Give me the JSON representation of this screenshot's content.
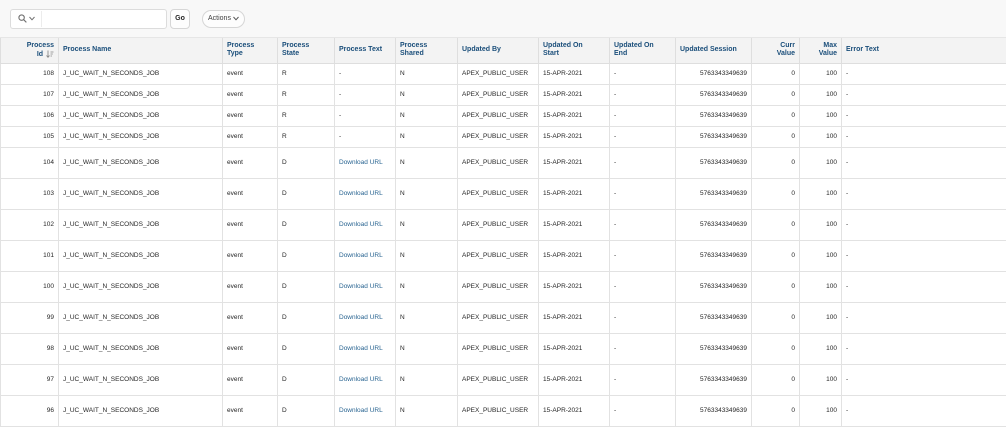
{
  "toolbar": {
    "search_value": "",
    "go_label": "Go",
    "actions_label": "Actions"
  },
  "columns": {
    "process_id": [
      "Process",
      "Id"
    ],
    "process_name": "Process Name",
    "process_type": [
      "Process",
      "Type"
    ],
    "process_state": [
      "Process",
      "State"
    ],
    "process_text": "Process Text",
    "process_shared": [
      "Process",
      "Shared"
    ],
    "updated_by": "Updated By",
    "updated_on_start": [
      "Updated On",
      "Start"
    ],
    "updated_on_end": [
      "Updated On",
      "End"
    ],
    "updated_session": "Updated Session",
    "curr_value": [
      "Curr",
      "Value"
    ],
    "max_value": [
      "Max",
      "Value"
    ],
    "error_text": "Error Text"
  },
  "rows": [
    {
      "id": "108",
      "name": "J_UC_WAIT_N_SECONDS_JOB",
      "type": "event",
      "state": "R",
      "text": "-",
      "shared": "N",
      "updated_by": "APEX_PUBLIC_USER",
      "start": "15-APR-2021",
      "end": "-",
      "session": "5763343349639",
      "curr": "0",
      "max": "100",
      "error": "-"
    },
    {
      "id": "107",
      "name": "J_UC_WAIT_N_SECONDS_JOB",
      "type": "event",
      "state": "R",
      "text": "-",
      "shared": "N",
      "updated_by": "APEX_PUBLIC_USER",
      "start": "15-APR-2021",
      "end": "-",
      "session": "5763343349639",
      "curr": "0",
      "max": "100",
      "error": "-"
    },
    {
      "id": "106",
      "name": "J_UC_WAIT_N_SECONDS_JOB",
      "type": "event",
      "state": "R",
      "text": "-",
      "shared": "N",
      "updated_by": "APEX_PUBLIC_USER",
      "start": "15-APR-2021",
      "end": "-",
      "session": "5763343349639",
      "curr": "0",
      "max": "100",
      "error": "-"
    },
    {
      "id": "105",
      "name": "J_UC_WAIT_N_SECONDS_JOB",
      "type": "event",
      "state": "R",
      "text": "-",
      "shared": "N",
      "updated_by": "APEX_PUBLIC_USER",
      "start": "15-APR-2021",
      "end": "-",
      "session": "5763343349639",
      "curr": "0",
      "max": "100",
      "error": "-"
    },
    {
      "id": "104",
      "name": "J_UC_WAIT_N_SECONDS_JOB",
      "type": "event",
      "state": "D",
      "text": "Download URL",
      "shared": "N",
      "updated_by": "APEX_PUBLIC_USER",
      "start": "15-APR-2021",
      "end": "-",
      "session": "5763343349639",
      "curr": "0",
      "max": "100",
      "error": "-"
    },
    {
      "id": "103",
      "name": "J_UC_WAIT_N_SECONDS_JOB",
      "type": "event",
      "state": "D",
      "text": "Download URL",
      "shared": "N",
      "updated_by": "APEX_PUBLIC_USER",
      "start": "15-APR-2021",
      "end": "-",
      "session": "5763343349639",
      "curr": "0",
      "max": "100",
      "error": "-"
    },
    {
      "id": "102",
      "name": "J_UC_WAIT_N_SECONDS_JOB",
      "type": "event",
      "state": "D",
      "text": "Download URL",
      "shared": "N",
      "updated_by": "APEX_PUBLIC_USER",
      "start": "15-APR-2021",
      "end": "-",
      "session": "5763343349639",
      "curr": "0",
      "max": "100",
      "error": "-"
    },
    {
      "id": "101",
      "name": "J_UC_WAIT_N_SECONDS_JOB",
      "type": "event",
      "state": "D",
      "text": "Download URL",
      "shared": "N",
      "updated_by": "APEX_PUBLIC_USER",
      "start": "15-APR-2021",
      "end": "-",
      "session": "5763343349639",
      "curr": "0",
      "max": "100",
      "error": "-"
    },
    {
      "id": "100",
      "name": "J_UC_WAIT_N_SECONDS_JOB",
      "type": "event",
      "state": "D",
      "text": "Download URL",
      "shared": "N",
      "updated_by": "APEX_PUBLIC_USER",
      "start": "15-APR-2021",
      "end": "-",
      "session": "5763343349639",
      "curr": "0",
      "max": "100",
      "error": "-"
    },
    {
      "id": "99",
      "name": "J_UC_WAIT_N_SECONDS_JOB",
      "type": "event",
      "state": "D",
      "text": "Download URL",
      "shared": "N",
      "updated_by": "APEX_PUBLIC_USER",
      "start": "15-APR-2021",
      "end": "-",
      "session": "5763343349639",
      "curr": "0",
      "max": "100",
      "error": "-"
    },
    {
      "id": "98",
      "name": "J_UC_WAIT_N_SECONDS_JOB",
      "type": "event",
      "state": "D",
      "text": "Download URL",
      "shared": "N",
      "updated_by": "APEX_PUBLIC_USER",
      "start": "15-APR-2021",
      "end": "-",
      "session": "5763343349639",
      "curr": "0",
      "max": "100",
      "error": "-"
    },
    {
      "id": "97",
      "name": "J_UC_WAIT_N_SECONDS_JOB",
      "type": "event",
      "state": "D",
      "text": "Download URL",
      "shared": "N",
      "updated_by": "APEX_PUBLIC_USER",
      "start": "15-APR-2021",
      "end": "-",
      "session": "5763343349639",
      "curr": "0",
      "max": "100",
      "error": "-"
    },
    {
      "id": "96",
      "name": "J_UC_WAIT_N_SECONDS_JOB",
      "type": "event",
      "state": "D",
      "text": "Download URL",
      "shared": "N",
      "updated_by": "APEX_PUBLIC_USER",
      "start": "15-APR-2021",
      "end": "-",
      "session": "5763343349639",
      "curr": "0",
      "max": "100",
      "error": "-"
    }
  ]
}
